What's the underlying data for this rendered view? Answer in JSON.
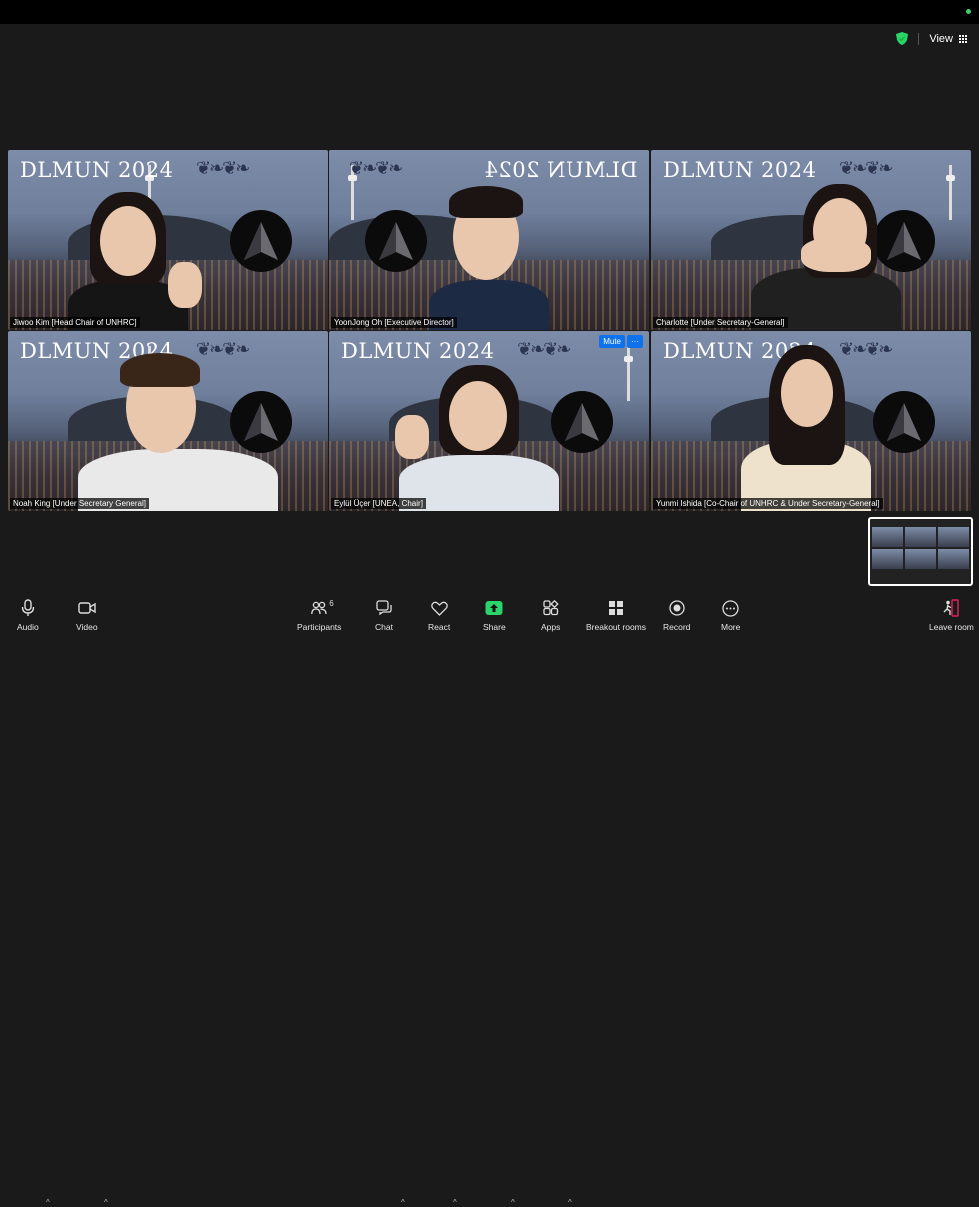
{
  "view": {
    "label": "View"
  },
  "tiles": [
    {
      "banner": "DLMUN 2024",
      "name": "Jiwoo Kim [Head Chair of UNHRC]"
    },
    {
      "banner": "DLMUN 2024",
      "name": "YoonJong Oh [Executive Director]"
    },
    {
      "banner": "DLMUN 2024",
      "name": "Charlotte [Under Secretary-General]"
    },
    {
      "banner": "DLMUN 2024",
      "name": "Noah King [Under Secretary General]"
    },
    {
      "banner": "DLMUN 2024",
      "name": "Eylül Üçer [UNEA, Chair]",
      "badge": "Mute",
      "more": "···"
    },
    {
      "banner": "DLMUN 2024",
      "name": "Yunmi Ishida [Co-Chair of UNHRC & Under Secretary-General]"
    }
  ],
  "toolbar": {
    "audio": "Audio",
    "video": "Video",
    "participants": "Participants",
    "participants_count": "6",
    "chat": "Chat",
    "react": "React",
    "share": "Share",
    "apps": "Apps",
    "breakout": "Breakout rooms",
    "record": "Record",
    "more": "More",
    "leave": "Leave room"
  },
  "colors": {
    "active_speaker": "#2ed35a",
    "share": "#2bd36b",
    "mute_badge": "#0e72ed"
  }
}
